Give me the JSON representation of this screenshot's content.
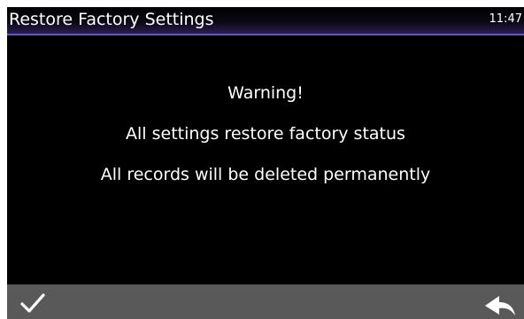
{
  "title_bar": {
    "title": "Restore Factory Settings",
    "time": "11:47"
  },
  "dialog": {
    "heading": "Warning!",
    "line1": "All settings restore factory status",
    "line2": "All records will be deleted permanently"
  },
  "bottom_bar": {
    "confirm_icon": "checkmark-icon",
    "back_icon": "back-arrow-icon"
  },
  "colors": {
    "background": "#000000",
    "title_accent": "#6a55b8",
    "bottom_bar": "#595959",
    "text": "#ffffff"
  }
}
